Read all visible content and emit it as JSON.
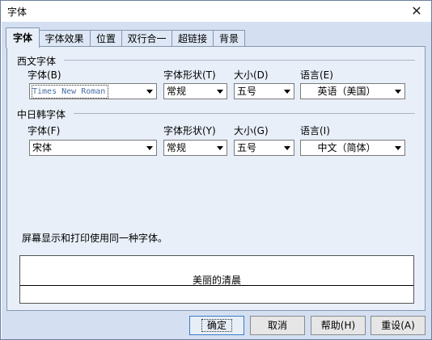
{
  "window": {
    "title": "字体",
    "close": "✕"
  },
  "tabs": [
    "字体",
    "字体效果",
    "位置",
    "双行合一",
    "超链接",
    "背景"
  ],
  "western": {
    "group_title": "西文字体",
    "font_label": "字体(B)",
    "style_label": "字体形状(T)",
    "size_label": "大小(D)",
    "lang_label": "语言(E)",
    "font_value": "Times New Roman",
    "style_value": "常规",
    "size_value": "五号",
    "lang_value": "英语（美国）"
  },
  "asian": {
    "group_title": "中日韩字体",
    "font_label": "字体(F)",
    "style_label": "字体形状(Y)",
    "size_label": "大小(G)",
    "lang_label": "语言(I)",
    "font_value": "宋体",
    "style_value": "常规",
    "size_value": "五号",
    "lang_value": "中文（简体）"
  },
  "note": "屏幕显示和打印使用同一种字体。",
  "preview_text": "美丽的清晨",
  "buttons": {
    "ok": "确定",
    "cancel": "取消",
    "help": "帮助(H)",
    "reset": "重设(A)"
  }
}
